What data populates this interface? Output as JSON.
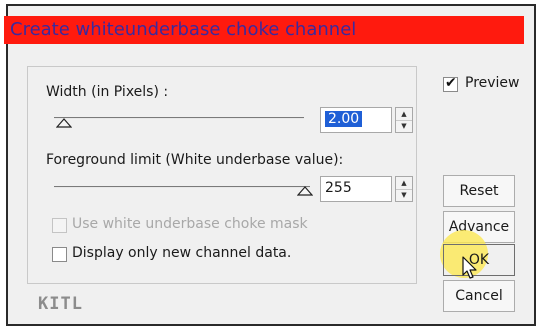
{
  "dialog": {
    "title": "Create whiteunderbase choke channel",
    "title_bar_color": "#ff1a0e",
    "title_text_color": "#3b2a9e"
  },
  "width": {
    "label": "Width (in Pixels) :",
    "value": "2.00"
  },
  "foreground": {
    "label": "Foreground limit (White underbase value):",
    "value": "255"
  },
  "options": {
    "use_mask_label": "Use white underbase choke mask",
    "use_mask_checked": false,
    "use_mask_enabled": false,
    "display_only_label": "Display only new channel data.",
    "display_only_checked": false
  },
  "preview": {
    "label": "Preview",
    "checked": true
  },
  "buttons": {
    "reset": "Reset",
    "advance": "Advance",
    "ok": "OK",
    "cancel": "Cancel"
  },
  "logo": "KITL",
  "icons": {
    "slider_thumb": "triangle-thumb-icon",
    "spin_up": "spin-up-icon",
    "spin_down": "spin-down-icon",
    "cursor": "mouse-pointer-icon"
  },
  "colors": {
    "selection": "#1f5fd6",
    "highlight": "#fce850"
  }
}
